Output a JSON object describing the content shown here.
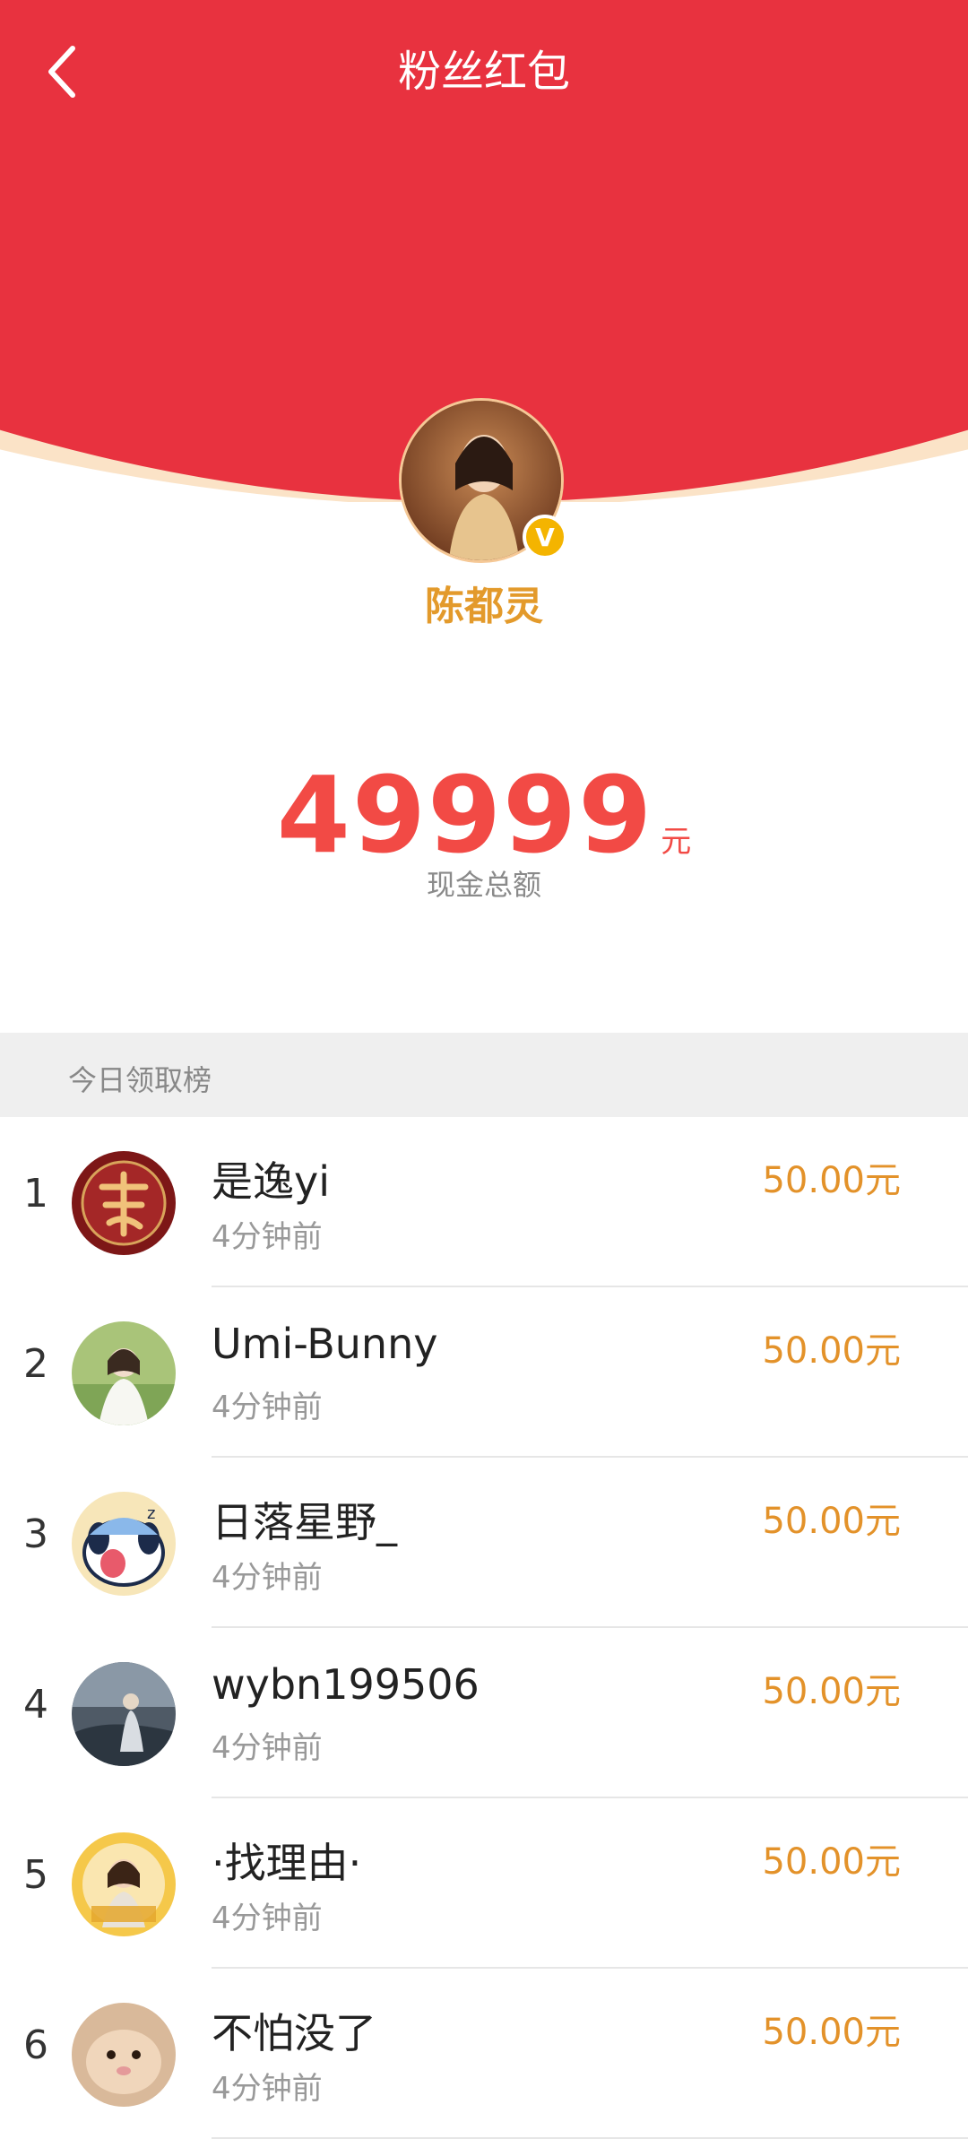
{
  "header": {
    "title": "粉丝红包",
    "back_icon": "chevron-left-icon"
  },
  "host": {
    "name": "陈都灵",
    "verified_badge": "V"
  },
  "total": {
    "amount": "49999",
    "unit": "元",
    "label": "现金总额"
  },
  "board": {
    "title": "今日领取榜",
    "rows": [
      {
        "rank": "1",
        "name": "是逸yi",
        "time": "4分钟前",
        "amount": "50.00元"
      },
      {
        "rank": "2",
        "name": "Umi-Bunny",
        "time": "4分钟前",
        "amount": "50.00元"
      },
      {
        "rank": "3",
        "name": "日落星野_",
        "time": "4分钟前",
        "amount": "50.00元"
      },
      {
        "rank": "4",
        "name": "wybn199506",
        "time": "4分钟前",
        "amount": "50.00元"
      },
      {
        "rank": "5",
        "name": "·找理由·",
        "time": "4分钟前",
        "amount": "50.00元"
      },
      {
        "rank": "6",
        "name": "不怕没了",
        "time": "4分钟前",
        "amount": "50.00元"
      }
    ]
  },
  "colors": {
    "header_red": "#e8323f",
    "gold": "#e39a2b",
    "amount_red": "#f24a45"
  }
}
